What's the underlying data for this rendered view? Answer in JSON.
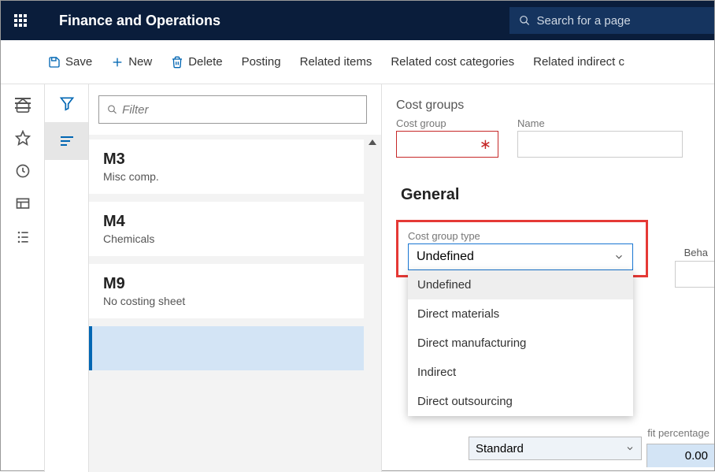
{
  "app_title": "Finance and Operations",
  "search_placeholder": "Search for a page",
  "commands": {
    "save": "Save",
    "new": "New",
    "delete": "Delete",
    "posting": "Posting",
    "related_items": "Related items",
    "related_cost_cat": "Related cost categories",
    "related_indirect": "Related indirect c"
  },
  "filter_placeholder": "Filter",
  "list": [
    {
      "code": "M3",
      "label": "Misc comp."
    },
    {
      "code": "M4",
      "label": "Chemicals"
    },
    {
      "code": "M9",
      "label": "No costing sheet"
    }
  ],
  "detail": {
    "page_title": "Cost groups",
    "cost_group_label": "Cost group",
    "name_label": "Name",
    "general_section": "General",
    "cost_group_type_label": "Cost group type",
    "cost_group_type_value": "Undefined",
    "cost_group_type_options": [
      "Undefined",
      "Direct materials",
      "Direct manufacturing",
      "Indirect",
      "Direct outsourcing"
    ],
    "behavior_label": "Beha",
    "profit_label": "fit percentage",
    "profit_value": "0.00",
    "under_value": "Standard"
  }
}
